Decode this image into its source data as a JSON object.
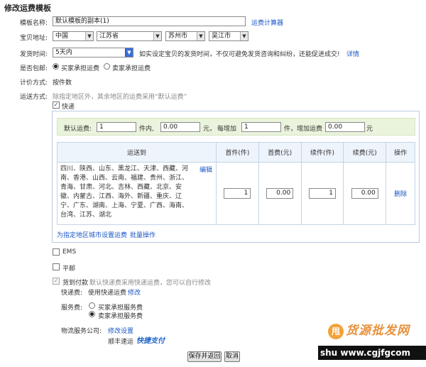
{
  "page": {
    "title": "修改运费模板"
  },
  "form": {
    "template_name": {
      "label": "模板名称:",
      "value": "默认模板的副本(1)",
      "calc_link": "运费计算器"
    },
    "address": {
      "label": "宝贝地址:",
      "country": "中国",
      "province": "江苏省",
      "city": "苏州市",
      "district": "吴江市"
    },
    "ship_time": {
      "label": "发货时间:",
      "value": "5天内",
      "hint": "如实设定宝贝的发货时间，不仅可避免发货咨询和纠纷，还能促进成交!",
      "detail_link": "详情"
    },
    "free_shipping": {
      "label": "是否包邮:",
      "opt_buyer": "买家承担运费",
      "opt_seller": "卖家承担运费"
    },
    "pricing": {
      "label": "计价方式:",
      "value": "按件数"
    },
    "shipping_method": {
      "label": "运送方式:",
      "note": "除指定地区外，其余地区的运费采用“默认运费”"
    }
  },
  "express": {
    "label": "快递",
    "default_row": {
      "label_default": "默认运费:",
      "first_qty": "1",
      "unit_piece": "件内,",
      "first_fee": "0.00",
      "unit_yuan": "元，",
      "each_add": "每增加",
      "add_qty": "1",
      "unit_piece2": "件，",
      "add_fee_label": "增加运费",
      "add_fee": "0.00",
      "unit_yuan2": "元"
    },
    "table": {
      "headers": [
        "运送到",
        "首件(件)",
        "首费(元)",
        "续件(件)",
        "续费(元)",
        "操作"
      ],
      "row": {
        "regions": "四川、陕西、山东、黑龙江、天津、西藏、河南、香港、山西、云南、福建、贵州、浙江、青海、甘肃、河北、吉林、西藏、北京、安徽、内蒙古、江西、海外、新疆、重庆、辽宁、广东、湖南、上海、宁夏、广西、海南、台湾、江苏、湖北",
        "edit": "编辑",
        "first_qty": "1",
        "first_fee": "0.00",
        "add_qty": "1",
        "add_fee": "0.00",
        "delete": "删除"
      }
    },
    "footer_link1": "为指定地区城市设置运费",
    "footer_link2": "批量操作"
  },
  "ems": {
    "label": "EMS"
  },
  "post": {
    "label": "平邮"
  },
  "cod": {
    "label": "货到付款",
    "note": "默认快递费采用快递运费，您可以自行修改",
    "fee_label": "快递费:",
    "fee_value": "使用快递运费",
    "fee_link": "修改",
    "service_label": "服务费:",
    "service_buyer": "买家承担服务费",
    "service_seller": "卖家承担服务费",
    "logistics_label": "物流服务公司:",
    "logistics_link": "修改设置",
    "company": "顺丰速运",
    "company_badge": "快捷支付"
  },
  "actions": {
    "save": "保存并返回",
    "cancel": "取消"
  },
  "watermark": {
    "brand": "货源批发网",
    "site": "shu www.cgjfgcom",
    "badge": "甩"
  },
  "colors": {
    "link": "#1a56c6",
    "panel_border": "#b7cbe0",
    "default_bar": "#eaf3dc"
  }
}
